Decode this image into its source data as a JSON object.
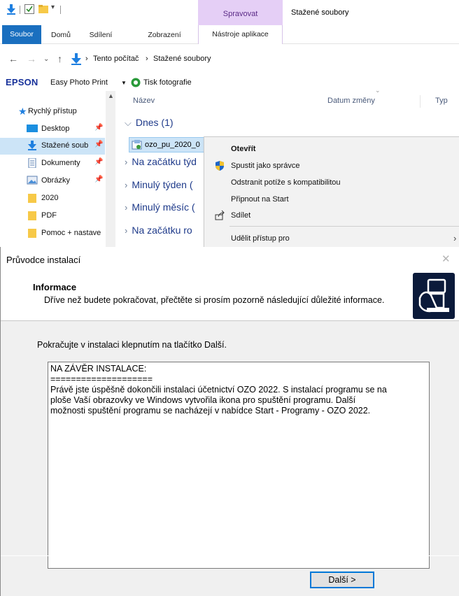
{
  "explorer": {
    "window_title": "Stažené soubory",
    "context_tab_group": "Spravovat",
    "ribbon_tabs": [
      "Soubor",
      "Domů",
      "Sdílení",
      "Zobrazení",
      "Nástroje aplikace"
    ],
    "address": {
      "crumb1": "Tento počítač",
      "crumb2": "Stažené soubory",
      "separator": "›"
    },
    "toolbar": {
      "brand": "EPSON",
      "easy_photo_print": "Easy Photo Print",
      "dropdown_arrow": "▼",
      "photo_print": "Tisk fotografie"
    },
    "nav": [
      {
        "label": "Rychlý přístup",
        "icon": "star-icon",
        "pinned": false
      },
      {
        "label": "Desktop",
        "icon": "desktop-icon",
        "pinned": true
      },
      {
        "label": "Stažené soub",
        "icon": "download-icon",
        "pinned": true,
        "selected": true
      },
      {
        "label": "Dokumenty",
        "icon": "document-icon",
        "pinned": true
      },
      {
        "label": "Obrázky",
        "icon": "pictures-icon",
        "pinned": true
      },
      {
        "label": "2020",
        "icon": "folder-icon",
        "pinned": false
      },
      {
        "label": "PDF",
        "icon": "folder-icon",
        "pinned": false
      },
      {
        "label": "Pomoc + nastave",
        "icon": "folder-icon",
        "pinned": false
      }
    ],
    "columns": {
      "name": "Název",
      "date": "Datum změny",
      "type": "Typ"
    },
    "groups": [
      {
        "label": "Dnes (1)",
        "expanded": true
      },
      {
        "label": "Na začátku týd",
        "expanded": false
      },
      {
        "label": "Minulý týden (",
        "expanded": false
      },
      {
        "label": "Minulý měsíc (",
        "expanded": false
      },
      {
        "label": "Na začátku ro",
        "expanded": false
      }
    ],
    "selected_file": "ozo_pu_2020_0",
    "context_menu": {
      "items": [
        {
          "label": "Otevřít",
          "bold": true,
          "icon": ""
        },
        {
          "label": "Spustit jako správce",
          "bold": false,
          "icon": "uac-shield-icon"
        },
        {
          "label": "Odstranit potíže s kompatibilitou",
          "bold": false,
          "icon": ""
        },
        {
          "label": "Připnout na Start",
          "bold": false,
          "icon": ""
        },
        {
          "label": "Sdílet",
          "bold": false,
          "icon": "share-icon"
        },
        {
          "label": "Udělit přístup pro",
          "bold": false,
          "icon": "",
          "submenu": true
        }
      ]
    }
  },
  "installer": {
    "title": "Průvodce instalací",
    "header_title": "Informace",
    "header_subtitle": "Dříve než budete pokračovat, přečtěte si prosím pozorně následující důležité informace.",
    "instruction": "Pokračujte v instalaci klepnutím na tlačítko Další.",
    "memo_lines": [
      "NA ZÁVĚR INSTALACE:",
      "====================",
      "Právě jste úspěšně dokončili instalaci účetnictví OZO 2022. S instalací programu se na",
      "ploše Vaší obrazovky ve Windows vytvořila ikona pro spuštění programu. Další",
      "možnosti spuštění programu se nacházejí v nabídce Start - Programy - OZO 2022."
    ],
    "next_button": "Další >"
  },
  "colors": {
    "file_tab": "#1a6fbf",
    "context_tab": "#e5cff6",
    "selection": "#cce4f7",
    "folder": "#f7c948",
    "focus_border": "#0078d7"
  }
}
